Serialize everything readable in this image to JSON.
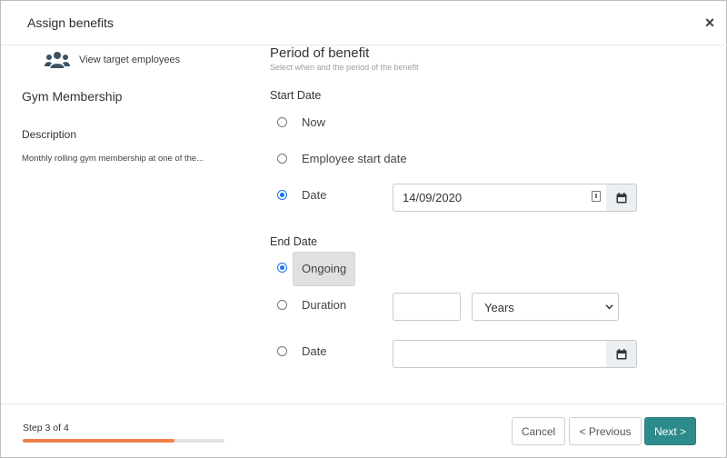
{
  "modal": {
    "title": "Assign benefits",
    "close_glyph": "×"
  },
  "left": {
    "view_target_label": "View target employees",
    "view_target_icon": "users-icon",
    "benefit_name": "Gym Membership",
    "description_heading": "Description",
    "description_text": "Monthly rolling gym membership at one of the..."
  },
  "period": {
    "title": "Period of benefit",
    "subtitle": "Select when and the period of the benefit"
  },
  "start_date": {
    "heading": "Start Date",
    "options": [
      {
        "label": "Now",
        "selected": false
      },
      {
        "label": "Employee start date",
        "selected": false
      },
      {
        "label": "Date",
        "selected": true
      }
    ],
    "date_value": "14/09/2020"
  },
  "end_date": {
    "heading": "End Date",
    "options": [
      {
        "label": "Ongoing",
        "selected": true
      },
      {
        "label": "Duration",
        "selected": false
      },
      {
        "label": "Date",
        "selected": false
      }
    ],
    "duration_value": "",
    "duration_unit": "Years",
    "date_value": ""
  },
  "footer": {
    "step_text": "Step 3 of 4",
    "progress_fraction": 0.75,
    "progress_color": "#f2814a",
    "cancel_label": "Cancel",
    "previous_label": "< Previous",
    "next_label": "Next >",
    "next_color": "#2e8b8b"
  }
}
